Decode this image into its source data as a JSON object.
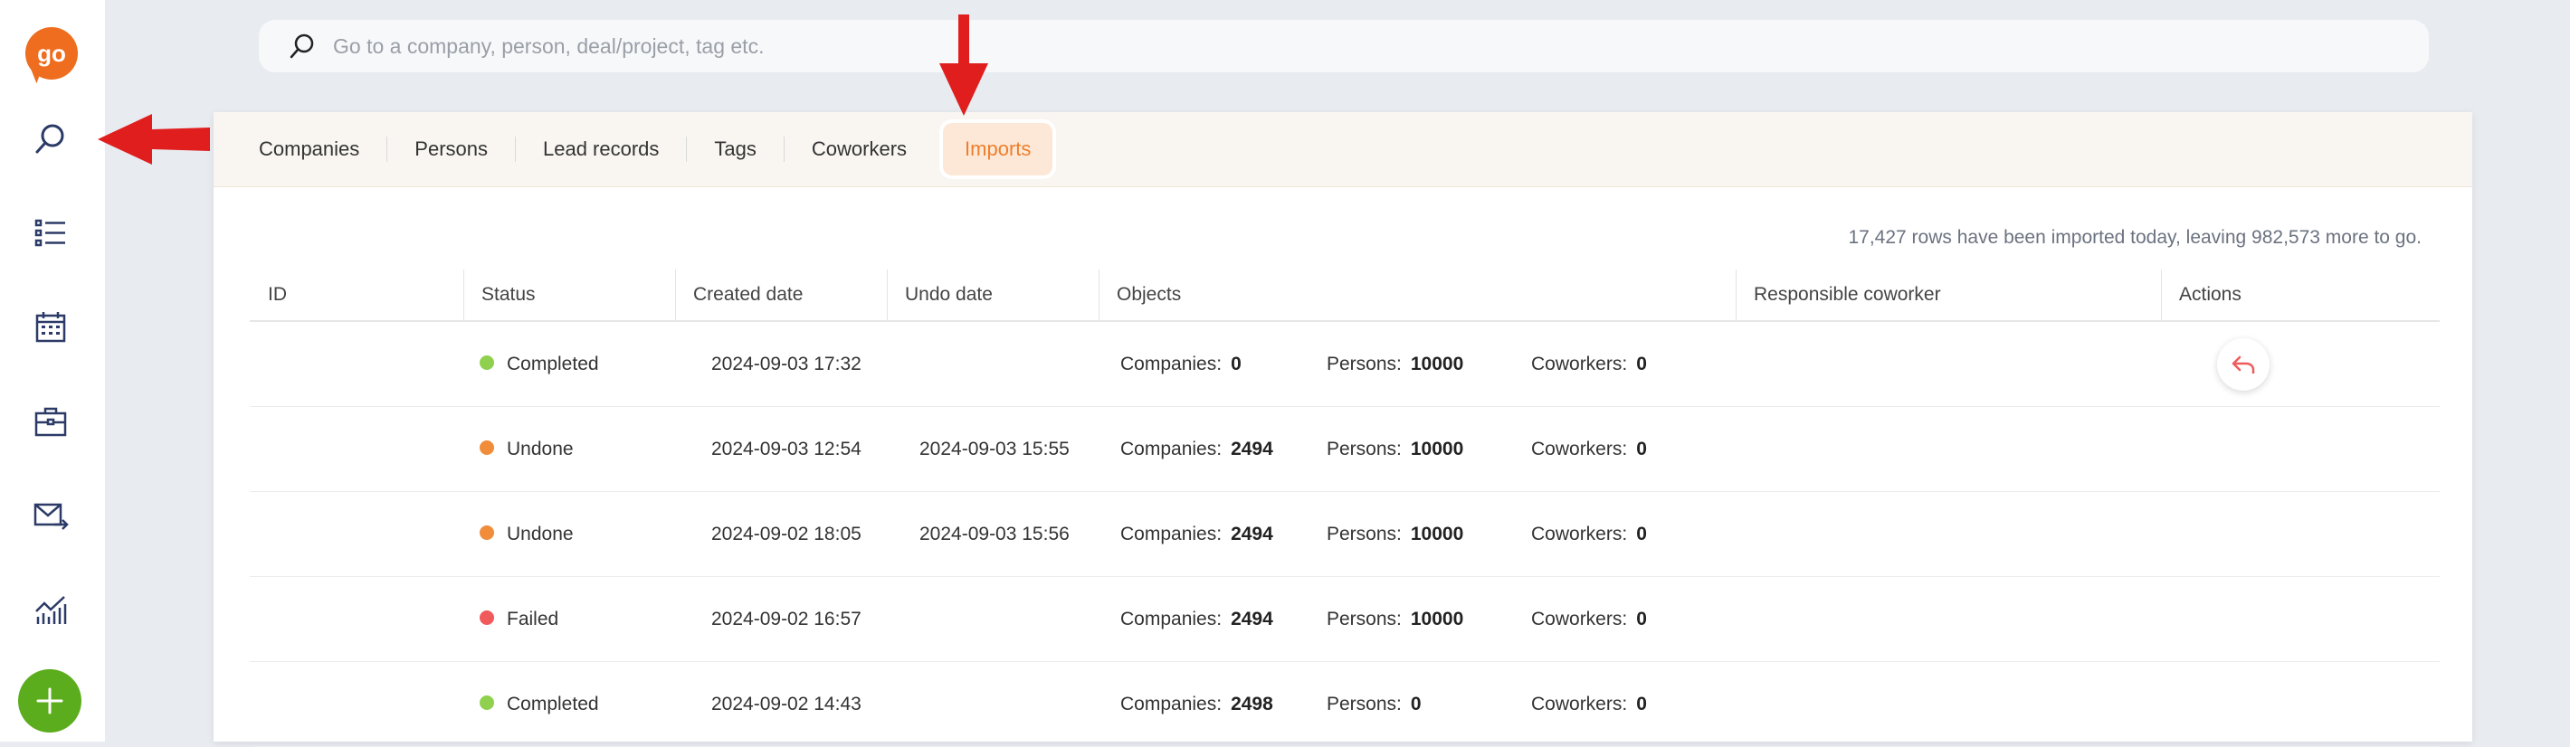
{
  "app": {
    "logo_text": "go",
    "brand_color": "#ee6d1e",
    "accent_color": "#ee7e2c",
    "add_color": "#5cad1e"
  },
  "sidebar": {
    "items": [
      {
        "icon": "search-icon"
      },
      {
        "icon": "list-icon"
      },
      {
        "icon": "calendar-icon"
      },
      {
        "icon": "briefcase-icon"
      },
      {
        "icon": "mail-icon"
      },
      {
        "icon": "chart-icon"
      }
    ],
    "add_icon": "plus-icon"
  },
  "search": {
    "placeholder": "Go to a company, person, deal/project, tag etc."
  },
  "tabs": [
    {
      "label": "Companies",
      "active": false
    },
    {
      "label": "Persons",
      "active": false
    },
    {
      "label": "Lead records",
      "active": false
    },
    {
      "label": "Tags",
      "active": false
    },
    {
      "label": "Coworkers",
      "active": false
    },
    {
      "label": "Imports",
      "active": true
    }
  ],
  "summary_text": "17,427 rows have been imported today, leaving 982,573 more to go.",
  "table": {
    "columns": [
      "ID",
      "Status",
      "Created date",
      "Undo date",
      "Objects",
      "Responsible coworker",
      "Actions"
    ],
    "object_labels": {
      "companies": "Companies:",
      "persons": "Persons:",
      "coworkers": "Coworkers:"
    },
    "status_colors": {
      "Completed": "#8fd14f",
      "Undone": "#f08c3a",
      "Failed": "#f05a5a"
    },
    "rows": [
      {
        "id": "",
        "status": "Completed",
        "created": "2024-09-03 17:32",
        "undo": "",
        "companies": "0",
        "persons": "10000",
        "coworkers": "0",
        "responsible": "",
        "has_undo_action": true
      },
      {
        "id": "",
        "status": "Undone",
        "created": "2024-09-03 12:54",
        "undo": "2024-09-03 15:55",
        "companies": "2494",
        "persons": "10000",
        "coworkers": "0",
        "responsible": "",
        "has_undo_action": false
      },
      {
        "id": "",
        "status": "Undone",
        "created": "2024-09-02 18:05",
        "undo": "2024-09-03 15:56",
        "companies": "2494",
        "persons": "10000",
        "coworkers": "0",
        "responsible": "",
        "has_undo_action": false
      },
      {
        "id": "",
        "status": "Failed",
        "created": "2024-09-02 16:57",
        "undo": "",
        "companies": "2494",
        "persons": "10000",
        "coworkers": "0",
        "responsible": "",
        "has_undo_action": false
      },
      {
        "id": "",
        "status": "Completed",
        "created": "2024-09-02 14:43",
        "undo": "",
        "companies": "2498",
        "persons": "0",
        "coworkers": "0",
        "responsible": "",
        "has_undo_action": false
      }
    ]
  },
  "annotations": {
    "arrow_color": "#e01e1e",
    "arrows": [
      {
        "target": "search-nav-icon",
        "direction": "left"
      },
      {
        "target": "tab-imports",
        "direction": "down"
      }
    ]
  }
}
